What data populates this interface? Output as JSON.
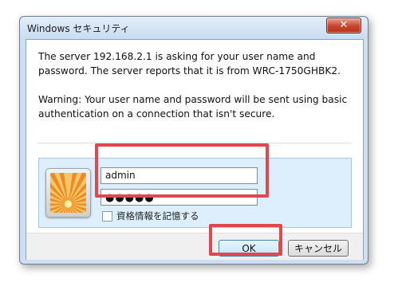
{
  "dialog": {
    "title": "Windows セキュリティ",
    "close_glyph": "✕",
    "message_line1": "The server 192.168.2.1 is asking for your user name and password. The server reports that it is from WRC-1750GHBK2.",
    "message_line2": "Warning: Your user name and password will be sent using basic authentication on a connection that isn't secure."
  },
  "credentials": {
    "username_value": "admin",
    "password_value": "●●●●●",
    "remember_label": "資格情報を記憶する",
    "remember_checked": false,
    "user_tile_icon": "user-tile-flower-icon"
  },
  "buttons": {
    "ok_label": "OK",
    "cancel_label": "キャンセル"
  },
  "colors": {
    "highlight": "#e0474f",
    "close_button": "#c7432b",
    "credential_panel": "#ddeefc"
  }
}
